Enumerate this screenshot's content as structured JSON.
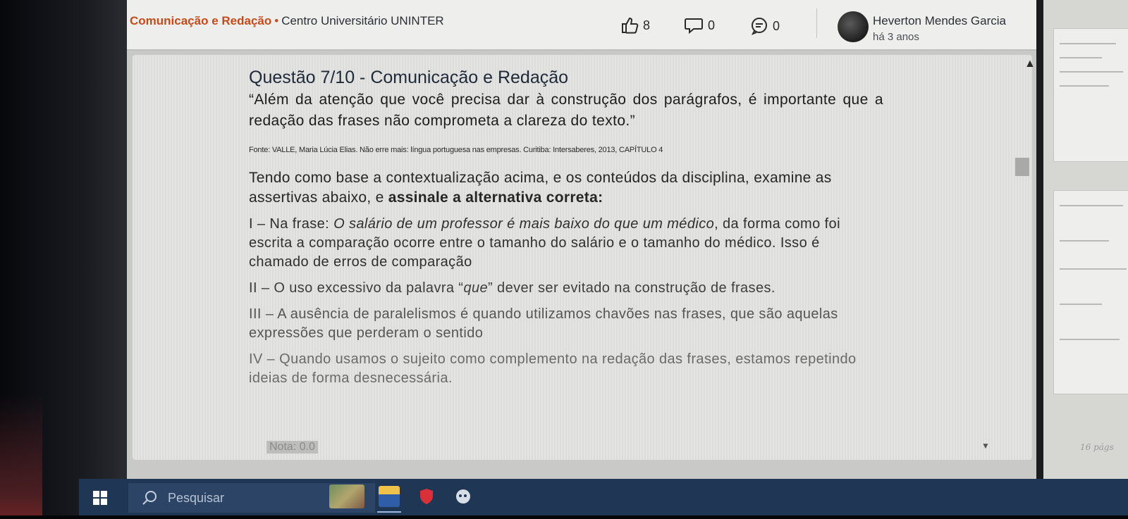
{
  "header": {
    "course": "Comunicação e Redação",
    "separator": "•",
    "institution": "Centro Universitário UNINTER",
    "likes": "8",
    "comments": "0",
    "messages": "0",
    "author_name": "Heverton Mendes Garcia",
    "author_time": "há 3 anos"
  },
  "question": {
    "title": "Questão 7/10 - Comunicação e Redação",
    "quote": "“Além da atenção que você precisa dar à construção dos parágrafos, é importante que a redação das frases não comprometa a clareza do texto.”",
    "source": "Fonte: VALLE, Maria Lúcia Elias. Não erre mais: língua portuguesa nas empresas. Curitiba: Intersaberes, 2013, CAPÍTULO 4",
    "instruction_plain": "Tendo como base a contextualização acima, e os conteúdos da disciplina, examine as assertivas abaixo, e ",
    "instruction_bold": "assinale a alternativa correta:",
    "assertion_1_pre": "I – Na frase: ",
    "assertion_1_italic": "O salário de um professor é mais baixo do que um médico",
    "assertion_1_post": ", da forma como foi escrita a comparação ocorre entre o tamanho do salário e o tamanho do médico. Isso é chamado de erros de comparação",
    "assertion_2_pre": "II – O uso excessivo da palavra “",
    "assertion_2_italic": "que",
    "assertion_2_post": "” dever ser evitado na construção de frases.",
    "assertion_3": "III – A ausência de paralelismos é quando utilizamos chavões nas frases, que são aquelas expressões que perderam o sentido",
    "assertion_4": "IV – Quando usamos o sujeito como complemento na redação das frases, estamos repetindo ideias de forma desnecessária.",
    "grade": "Nota: 0.0"
  },
  "sidebar": {
    "page_count": "16 págs"
  },
  "taskbar": {
    "search_placeholder": "Pesquisar"
  },
  "colors": {
    "accent": "#c44a1a",
    "taskbar": "#1f3655"
  }
}
